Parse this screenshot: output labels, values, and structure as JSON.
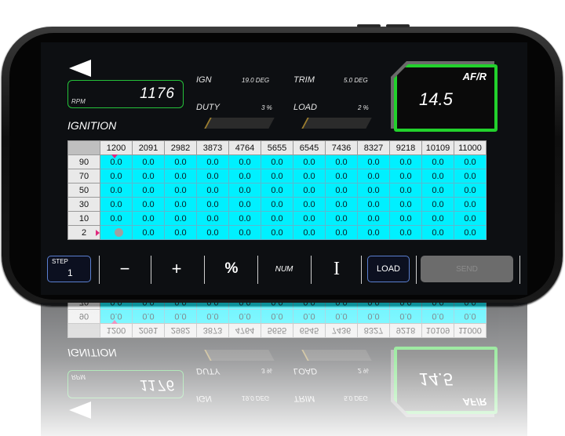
{
  "header": {
    "rpm_label": "RPM",
    "rpm_value": "1176",
    "ign_label": "IGN",
    "ign_value": "19.0 DEG",
    "trim_label": "TRIM",
    "trim_value": "5.0 DEG",
    "duty_label": "DUTY",
    "duty_value": "3 %",
    "load_label": "LOAD",
    "load_value": "2 %",
    "afr_label": "AF/R",
    "afr_value": "14.5",
    "mode_title": "IGNITION"
  },
  "table": {
    "columns": [
      "1200",
      "2091",
      "2982",
      "3873",
      "4764",
      "5655",
      "6545",
      "7436",
      "8327",
      "9218",
      "10109",
      "11000"
    ],
    "rows": [
      {
        "label": "90",
        "cells": [
          "0.0",
          "0.0",
          "0.0",
          "0.0",
          "0.0",
          "0.0",
          "0.0",
          "0.0",
          "0.0",
          "0.0",
          "0.0",
          "0.0"
        ]
      },
      {
        "label": "70",
        "cells": [
          "0.0",
          "0.0",
          "0.0",
          "0.0",
          "0.0",
          "0.0",
          "0.0",
          "0.0",
          "0.0",
          "0.0",
          "0.0",
          "0.0"
        ]
      },
      {
        "label": "50",
        "cells": [
          "0.0",
          "0.0",
          "0.0",
          "0.0",
          "0.0",
          "0.0",
          "0.0",
          "0.0",
          "0.0",
          "0.0",
          "0.0",
          "0.0"
        ]
      },
      {
        "label": "30",
        "cells": [
          "0.0",
          "0.0",
          "0.0",
          "0.0",
          "0.0",
          "0.0",
          "0.0",
          "0.0",
          "0.0",
          "0.0",
          "0.0",
          "0.0"
        ]
      },
      {
        "label": "10",
        "cells": [
          "0.0",
          "0.0",
          "0.0",
          "0.0",
          "0.0",
          "0.0",
          "0.0",
          "0.0",
          "0.0",
          "0.0",
          "0.0",
          "0.0"
        ]
      },
      {
        "label": "2",
        "cells": [
          "",
          "0.0",
          "0.0",
          "0.0",
          "0.0",
          "0.0",
          "0.0",
          "0.0",
          "0.0",
          "0.0",
          "0.0",
          "0.0"
        ]
      }
    ]
  },
  "toolbar": {
    "step_label": "STEP",
    "step_value": "1",
    "minus_label": "−",
    "plus_label": "+",
    "percent_label": "%",
    "num_label": "NUM",
    "cursor_label": "I",
    "load_label": "LOAD",
    "send_label": "SEND"
  },
  "colors": {
    "cell_bg": "#00f0ff",
    "rpm_border": "#25c23a",
    "afr_border": "#22d12c",
    "marker": "#e0297f",
    "button_border": "#5a7fd0"
  }
}
